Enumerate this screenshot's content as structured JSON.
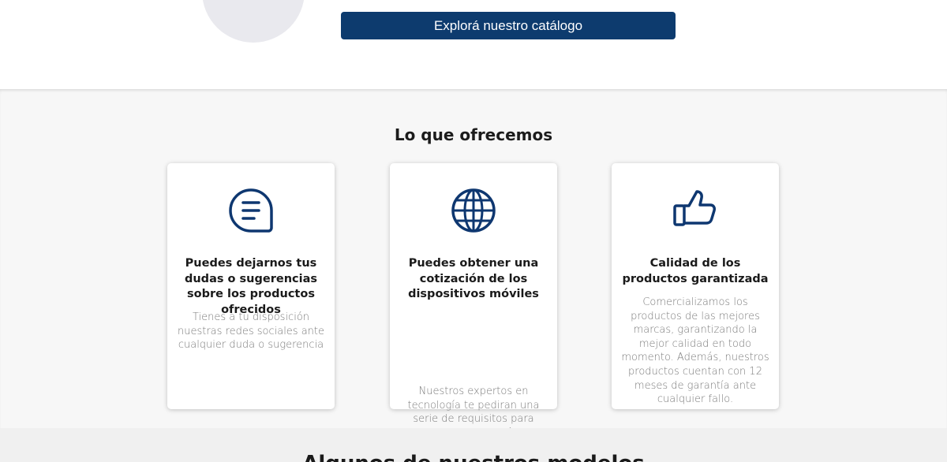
{
  "hero": {
    "cta_label": "Explorá nuestro catálogo"
  },
  "offer": {
    "title": "Lo que ofrecemos",
    "cards": [
      {
        "icon": "chat-bubble-icon",
        "title": "Puedes dejarnos tus dudas o sugerencias sobre los productos ofrecidos",
        "text": "Tienes a tu disposición nuestras redes sociales ante cualquier duda o sugerencia"
      },
      {
        "icon": "globe-icon",
        "title": "Puedes obtener una cotización de los dispositivos móviles",
        "text": "Nuestros expertos en tecnología te pediran una serie de requisitos para acercarte la cotización mas acorde y en menor tiempo."
      },
      {
        "icon": "thumbs-up-icon",
        "title": "Calidad de los productos garantizada",
        "text": "Comercializamos los productos de las mejores marcas, garantizando la mejor calidad en todo momento. Además, nuestros productos cuentan con 12 meses de garantía ante cualquier fallo."
      }
    ]
  },
  "bottom": {
    "title": "Algunos de nuestros modelos"
  },
  "colors": {
    "primary": "#0d3b6e",
    "icon": "#0e3770",
    "section_bg": "#f7f7f7"
  }
}
